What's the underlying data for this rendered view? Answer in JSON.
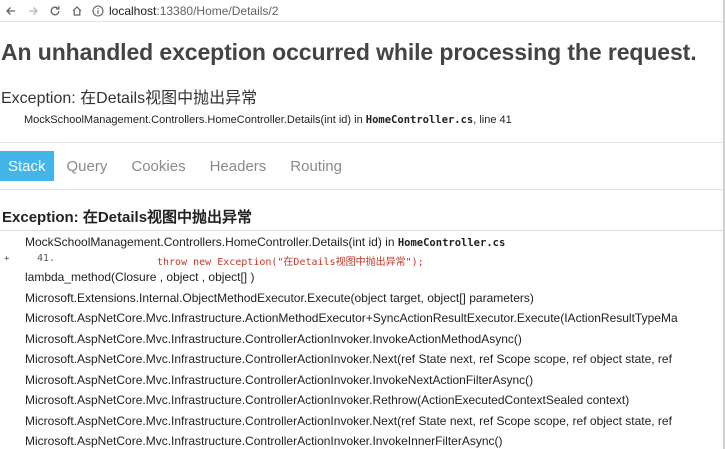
{
  "browser": {
    "url_host": "localhost",
    "url_rest": ":13380/Home/Details/2"
  },
  "page": {
    "title": "An unhandled exception occurred while processing the request.",
    "exception_title": "Exception: 在Details视图中抛出异常",
    "location_prefix": "MockSchoolManagement.Controllers.HomeController.Details(int id) in ",
    "location_file": "HomeController.cs",
    "location_suffix": ", line 41"
  },
  "tabs": [
    {
      "label": "Stack",
      "active": true
    },
    {
      "label": "Query",
      "active": false
    },
    {
      "label": "Cookies",
      "active": false
    },
    {
      "label": "Headers",
      "active": false
    },
    {
      "label": "Routing",
      "active": false
    }
  ],
  "stack": {
    "heading": "Exception: 在Details视图中抛出异常",
    "first_frame_prefix": "MockSchoolManagement.Controllers.HomeController.Details(int id) in ",
    "first_frame_file": "HomeController.cs",
    "expander": "+",
    "source_line_number": "41.",
    "source_line_code": "throw new Exception(\"在Details视图中抛出异常\");",
    "frames": [
      "lambda_method(Closure , object , object[] )",
      "Microsoft.Extensions.Internal.ObjectMethodExecutor.Execute(object target, object[] parameters)",
      "Microsoft.AspNetCore.Mvc.Infrastructure.ActionMethodExecutor+SyncActionResultExecutor.Execute(IActionResultTypeMa",
      "Microsoft.AspNetCore.Mvc.Infrastructure.ControllerActionInvoker.InvokeActionMethodAsync()",
      "Microsoft.AspNetCore.Mvc.Infrastructure.ControllerActionInvoker.Next(ref State next, ref Scope scope, ref object state, ref",
      "Microsoft.AspNetCore.Mvc.Infrastructure.ControllerActionInvoker.InvokeNextActionFilterAsync()",
      "Microsoft.AspNetCore.Mvc.Infrastructure.ControllerActionInvoker.Rethrow(ActionExecutedContextSealed context)",
      "Microsoft.AspNetCore.Mvc.Infrastructure.ControllerActionInvoker.Next(ref State next, ref Scope scope, ref object state, ref",
      "Microsoft.AspNetCore.Mvc.Infrastructure.ControllerActionInvoker.InvokeInnerFilterAsync()"
    ]
  },
  "colors": {
    "active_tab": "#44b5e8",
    "source_code": "#c0392b"
  }
}
